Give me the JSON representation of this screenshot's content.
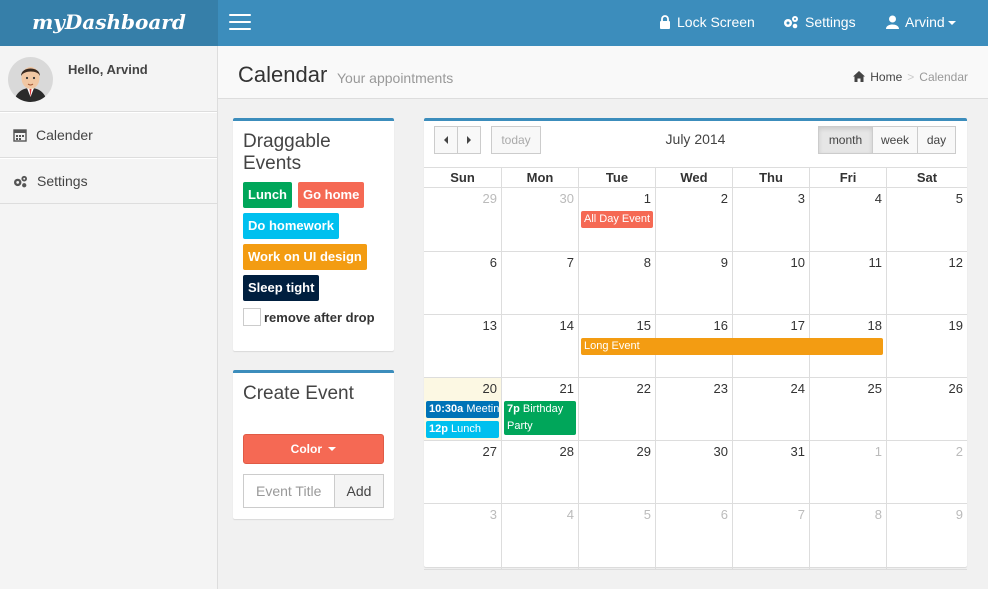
{
  "app": {
    "logo": "myDashboard",
    "nav": {
      "lock": "Lock Screen",
      "settings": "Settings",
      "user": "Arvind"
    }
  },
  "sidebar": {
    "greeting": "Hello, Arvind",
    "items": [
      {
        "label": "Calender",
        "icon": "calendar-icon"
      },
      {
        "label": "Settings",
        "icon": "gears-icon"
      }
    ]
  },
  "header": {
    "title": "Calendar",
    "subtitle": "Your appointments",
    "breadcrumb": {
      "home": "Home",
      "current": "Calendar"
    }
  },
  "draggable": {
    "title": "Draggable Events",
    "events": [
      {
        "label": "Lunch",
        "color": "#00a65a"
      },
      {
        "label": "Go home",
        "color": "#f56954"
      },
      {
        "label": "Do homework",
        "color": "#00c0ef"
      },
      {
        "label": "Work on UI design",
        "color": "#f39c12"
      },
      {
        "label": "Sleep tight",
        "color": "#001f3f"
      }
    ],
    "remove_label": "remove after drop"
  },
  "create": {
    "title": "Create Event",
    "color_label": "Color",
    "input_placeholder": "Event Title",
    "add_label": "Add"
  },
  "calendar": {
    "title": "July 2014",
    "today_label": "today",
    "views": [
      "month",
      "week",
      "day"
    ],
    "active_view": "month",
    "weekdays": [
      "Sun",
      "Mon",
      "Tue",
      "Wed",
      "Thu",
      "Fri",
      "Sat"
    ],
    "weeks": [
      [
        "29",
        "30",
        "1",
        "2",
        "3",
        "4",
        "5"
      ],
      [
        "6",
        "7",
        "8",
        "9",
        "10",
        "11",
        "12"
      ],
      [
        "13",
        "14",
        "15",
        "16",
        "17",
        "18",
        "19"
      ],
      [
        "20",
        "21",
        "22",
        "23",
        "24",
        "25",
        "26"
      ],
      [
        "27",
        "28",
        "29",
        "30",
        "31",
        "1",
        "2"
      ],
      [
        "3",
        "4",
        "5",
        "6",
        "7",
        "8",
        "9"
      ]
    ],
    "events": [
      {
        "time": "",
        "title": "All Day Event",
        "color": "#f56954"
      },
      {
        "time": "",
        "title": "Long Event",
        "color": "#f39c12"
      },
      {
        "time": "10:30a",
        "title": "Meeting",
        "color": "#0073b7"
      },
      {
        "time": "12p",
        "title": "Lunch",
        "color": "#00c0ef"
      },
      {
        "time": "7p",
        "title": "Birthday Party",
        "color": "#00a65a"
      }
    ]
  }
}
